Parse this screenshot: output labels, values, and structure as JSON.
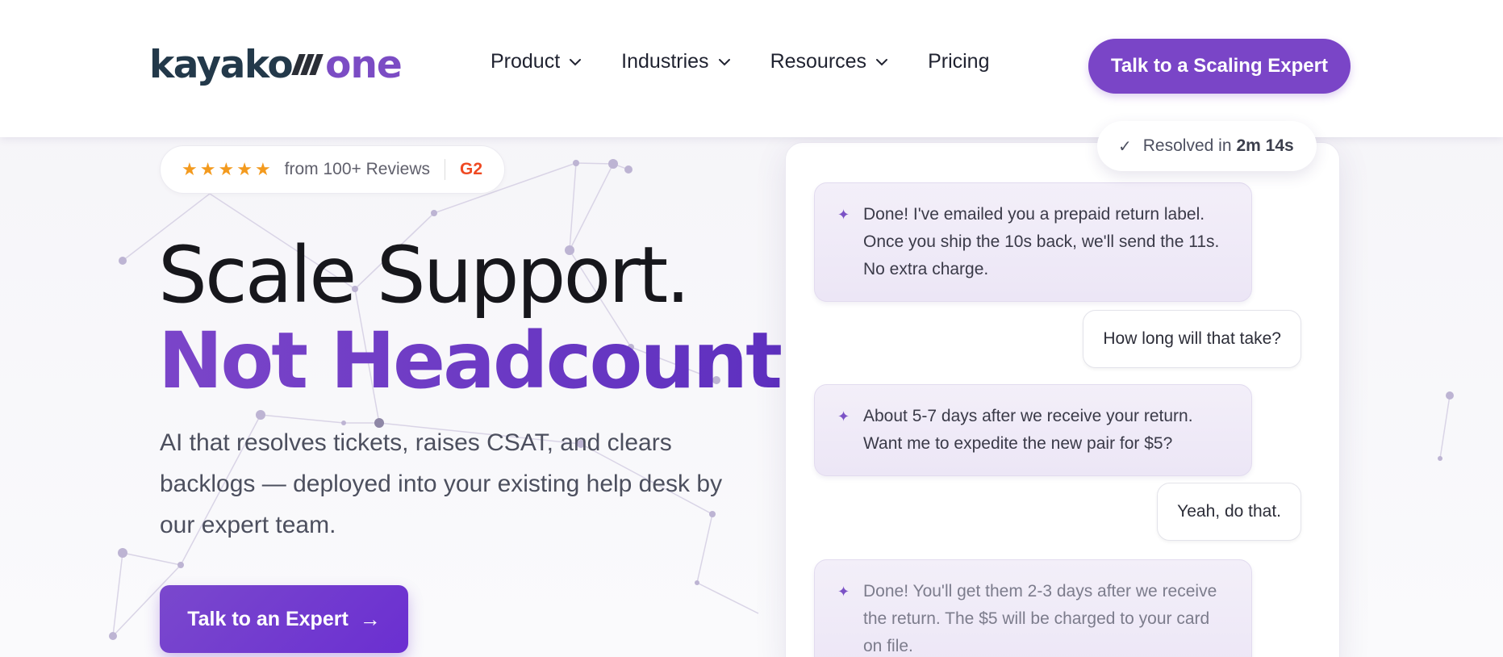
{
  "header": {
    "logo": {
      "part1": "kayako",
      "part2": "one"
    },
    "nav": [
      {
        "label": "Product",
        "has_dropdown": true
      },
      {
        "label": "Industries",
        "has_dropdown": true
      },
      {
        "label": "Resources",
        "has_dropdown": true
      },
      {
        "label": "Pricing",
        "has_dropdown": false
      }
    ],
    "cta_label": "Talk to a Scaling Expert"
  },
  "hero": {
    "reviews": {
      "stars": 5,
      "text": "from 100+ Reviews",
      "badge": "G2"
    },
    "headline_line1": "Scale Support.",
    "headline_line2": "Not Headcount.",
    "subtext": "AI that resolves tickets, raises CSAT, and clears backlogs — deployed into your existing help desk by our expert team.",
    "cta_label": "Talk to an Expert",
    "cta_arrow": "→"
  },
  "chat": {
    "resolved_prefix": "Resolved in",
    "resolved_time": "2m 14s",
    "messages": [
      {
        "role": "ai",
        "text": "Done! I've emailed you a prepaid return label. Once you ship the 10s back, we'll send the 11s. No extra charge."
      },
      {
        "role": "user",
        "text": "How long will that take?"
      },
      {
        "role": "ai",
        "text": "About 5-7 days after we receive your return. Want me to expedite the new pair for $5?"
      },
      {
        "role": "user",
        "text": "Yeah, do that."
      },
      {
        "role": "ai",
        "text": "Done! You'll get them 2-3 days after we receive the return. The $5 will be charged to your card on file."
      }
    ]
  },
  "colors": {
    "brand_purple": "#7a45c7",
    "headline_purple": "#6a35c4",
    "logo_dark": "#23394a",
    "star_orange": "#f39a1e",
    "g2_red": "#ef4a23"
  },
  "icons": {
    "nav_dropdown": "chevron-down-icon",
    "resolved": "check-icon",
    "ai_message": "sparkle-icon",
    "review": "star-icon"
  }
}
